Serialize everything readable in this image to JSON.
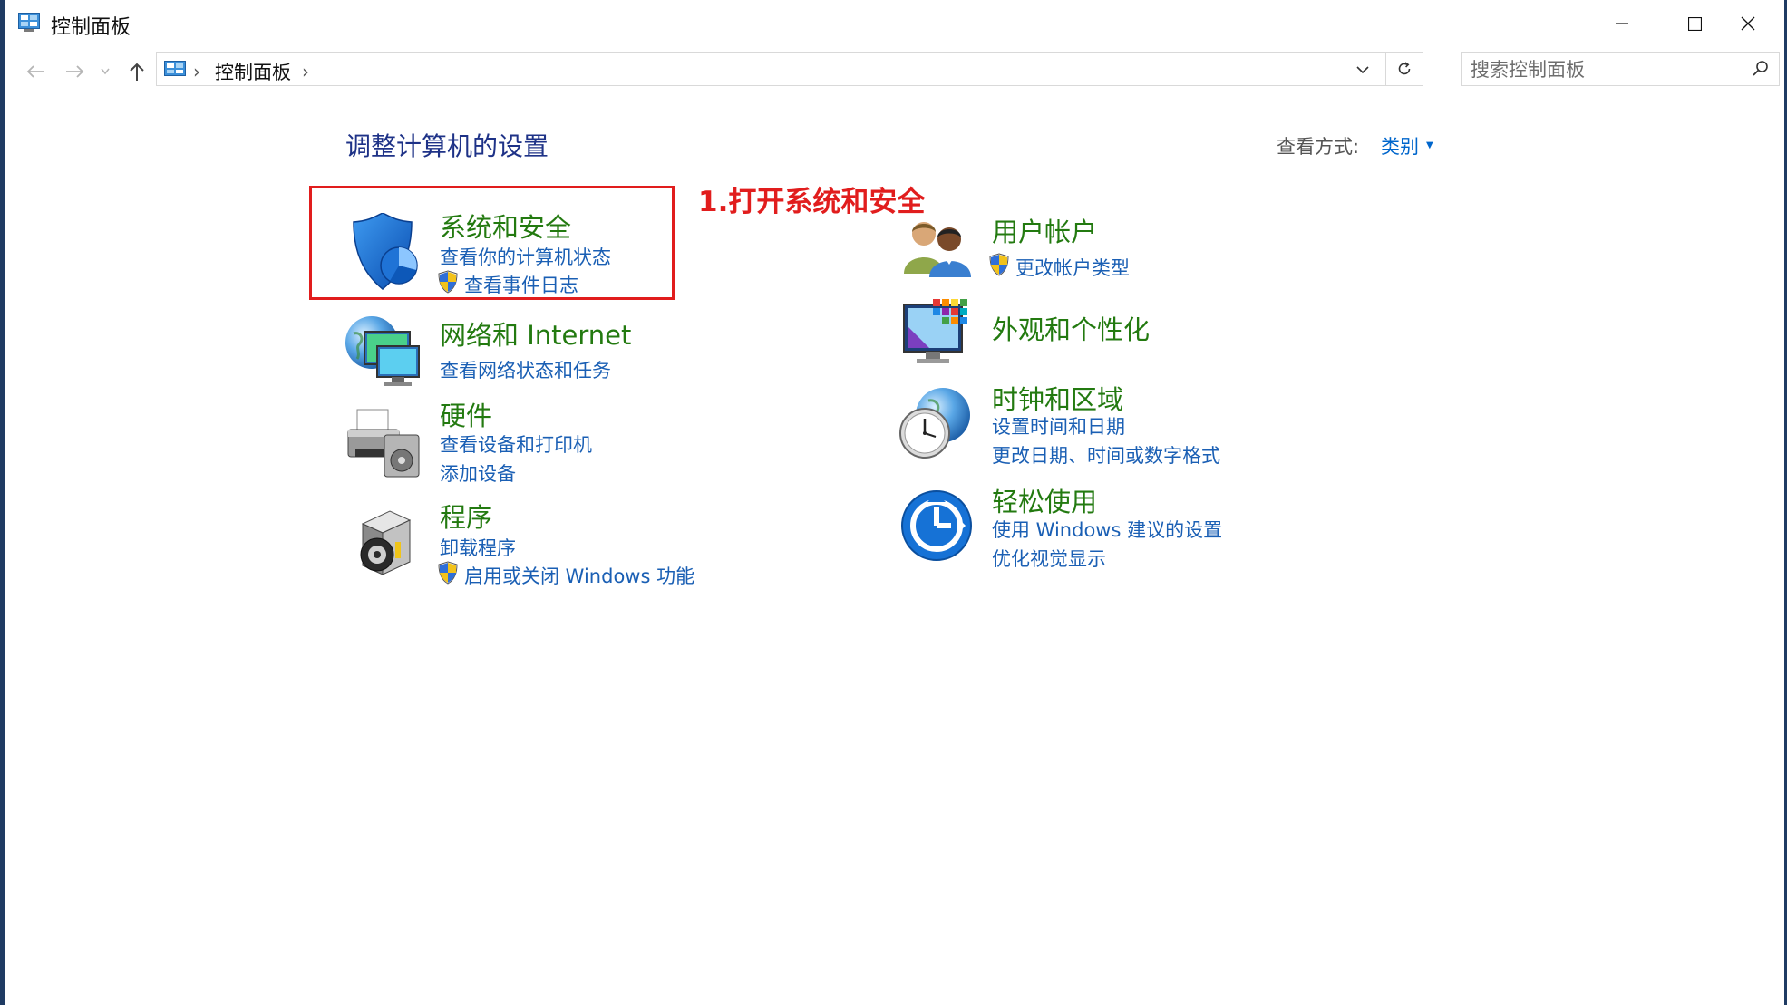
{
  "window": {
    "title": "控制面板"
  },
  "address": {
    "crumb": "控制面板"
  },
  "search": {
    "placeholder": "搜索控制面板"
  },
  "page": {
    "title": "调整计算机的设置"
  },
  "view": {
    "label": "查看方式:",
    "value": "类别"
  },
  "annotation": {
    "text": "1.打开系统和安全",
    "color": "#e11d1d"
  },
  "categories": {
    "system": {
      "title": "系统和安全",
      "links": [
        "查看你的计算机状态",
        "查看事件日志"
      ]
    },
    "network": {
      "title": "网络和 Internet",
      "links": [
        "查看网络状态和任务"
      ]
    },
    "hardware": {
      "title": "硬件",
      "links": [
        "查看设备和打印机",
        "添加设备"
      ]
    },
    "programs": {
      "title": "程序",
      "links": [
        "卸载程序",
        "启用或关闭 Windows 功能"
      ]
    },
    "accounts": {
      "title": "用户帐户",
      "links": [
        "更改帐户类型"
      ]
    },
    "appearance": {
      "title": "外观和个性化",
      "links": []
    },
    "clock": {
      "title": "时钟和区域",
      "links": [
        "设置时间和日期",
        "更改日期、时间或数字格式"
      ]
    },
    "ease": {
      "title": "轻松使用",
      "links": [
        "使用 Windows 建议的设置",
        "优化视觉显示"
      ]
    }
  },
  "colors": {
    "category_title": "#237a10",
    "link": "#1a5fb4",
    "page_title": "#1e3287",
    "frame": "#1f3b63"
  }
}
